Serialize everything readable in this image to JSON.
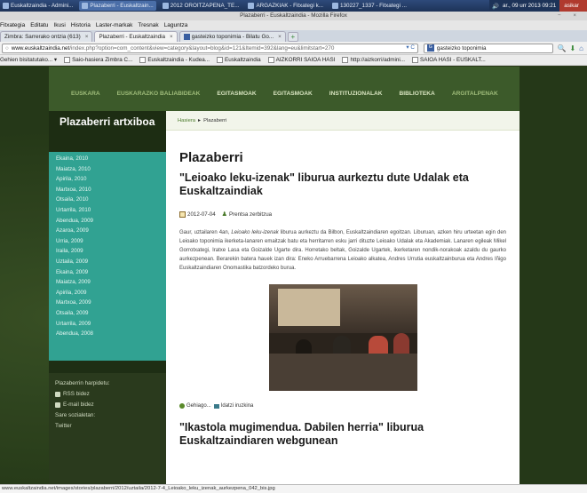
{
  "taskbar": {
    "items": [
      "Euskaltzaindia - Admini...",
      "Plazaberri - Euskaltzain...",
      "2012 OROITZAPENA_TE...",
      "ARGAZKIAK - Fitxategi k...",
      "130227_1337 - Fitxategi ..."
    ],
    "clock": "ar., 09 urr 2013 09:21",
    "user": "asikar"
  },
  "browser": {
    "title": "Plazaberri - Euskaltzaindia - Mozilla Firefox",
    "menu": [
      "Fitxategia",
      "Editatu",
      "Ikusi",
      "Historia",
      "Laster-markak",
      "Tresnak",
      "Laguntza"
    ],
    "tabs": [
      {
        "label": "Zimbra: Sarrerako ontzia (613)"
      },
      {
        "label": "Plazaberri - Euskaltzaindia"
      },
      {
        "label": "gasteizko toponimia - Bilatu Go..."
      }
    ],
    "url_domain": "www.euskaltzaindia.net",
    "url_rest": "/index.php?option=com_content&view=category&layout=blog&id=121&Itemid=392&lang=eu&limitstart=270",
    "search_value": "gasteizko toponimia",
    "bookmarks": [
      "Gehien bisitatutako...",
      "Saio-hasiera Zimbra C...",
      "Euskaltzaindia - Kudea...",
      "Euskaltzaindia",
      "AIZKORRI SAIOA HASI",
      "http://aizkorri/admini...",
      "SAIOA HASI - EUSKALT..."
    ]
  },
  "site": {
    "topnav": [
      "EUSKARA",
      "EUSKARAZKO BALIABIDEAK",
      "EGITASMOAK",
      "EGITASMOAK",
      "INSTITUZIONALAK",
      "BIBLIOTEKA",
      "ARGITALPENAK"
    ],
    "sidebar_title": "Plazaberri artxiboa",
    "archive": [
      "Ekaina, 2010",
      "Maiatza, 2010",
      "Apirila, 2010",
      "Martxoa, 2010",
      "Otsaila, 2010",
      "Urtarrila, 2010",
      "Abendua, 2009",
      "Azaroa, 2009",
      "Urria, 2009",
      "Iraila, 2009",
      "Uztaila, 2009",
      "Ekaina, 2009",
      "Maiatza, 2009",
      "Apirila, 2009",
      "Martxoa, 2009",
      "Otsaila, 2009",
      "Urtarrila, 2009",
      "Abendua, 2008"
    ],
    "subscribe": {
      "heading": "Plazaberrin harpidetu:",
      "rss": "RSS bidez",
      "email": "E-mail bidez",
      "social": "Sare sozialetan:",
      "twitter": "Twitter"
    },
    "breadcrumb": {
      "home": "Hasiera",
      "current": "Plazaberri"
    },
    "page_title": "Plazaberri",
    "article1": {
      "title": "\"Leioako leku-izenak\" liburua aurkeztu dute Udalak eta Euskaltzaindiak",
      "date": "2012-07-04",
      "author": "Prentsa zerbitzua",
      "body_before": "Gaur, uztailaren 4an, ",
      "body_italic": "Leioako leku-izenak",
      "body_after": " liburua aurkeztu da Bilbon, Euskaltzaindiaren egoitzan. Liburuan, azken hiru urteetan egin den Leioako toponimia ikerketa-lanaren emaitzak batu eta herritarren esku jarri dituzte Leioako Udalak eta Akademiak. Lanaren egileak Mikel Gorrotxategi, Iratxe Lasa eta Goizalde Ugarte dira. Horretako beltak, Goizalde Ugartek, ikerketaren nondik-norakoak azaldu du gaurko aurkezpenean. Berarekin batera hauek izan dira: Eneko Arruebarrena Leioako alkatea, Andres Urrutia euskaltzainburua eta Andres Iñigo Euskaltzaindiaren Onomastika batzordeko burua.",
      "more": "Gehiago...",
      "comments": "Idatzi iruzkina"
    },
    "article2": {
      "title": "\"Ikastola mugimendua. Dabilen herria\" liburua Euskaltzaindiaren webgunean"
    }
  },
  "statusbar": "www.euskaltzaindia.net/images/stories/plazaberri/2012/uztaila/2012-7-4_Leioako_leku_izenak_aurkezpena_042_bis.jpg"
}
